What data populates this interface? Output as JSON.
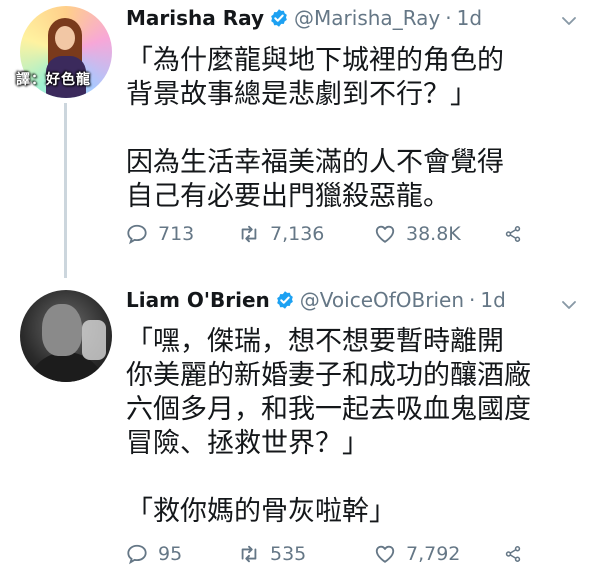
{
  "watermark": "譯：好色龍",
  "tweets": [
    {
      "name": "Marisha Ray",
      "handle": "@Marisha_Ray",
      "separator": "·",
      "time": "1d",
      "paragraphs": [
        [
          "「為什麼龍與地下城裡的角色的",
          "背景故事總是悲劇到不行？」"
        ],
        [
          "因為生活幸福美滿的人不會覺得",
          "自己有必要出門獵殺惡龍。"
        ]
      ],
      "replies": "713",
      "retweets": "7,136",
      "likes": "38.8K"
    },
    {
      "name": "Liam O'Brien",
      "handle": "@VoiceOfOBrien",
      "separator": "·",
      "time": "1d",
      "paragraphs": [
        [
          "「嘿，傑瑞，想不想要暫時離開",
          "你美麗的新婚妻子和成功的釀酒廠",
          "六個多月，和我一起去吸血鬼國度",
          "冒險、拯救世界？」"
        ],
        [
          "「救你媽的骨灰啦幹」"
        ]
      ],
      "replies": "95",
      "retweets": "535",
      "likes": "7,792"
    }
  ],
  "colors": {
    "text": "#14171a",
    "secondary": "#657786",
    "verified": "#1da1f2",
    "thread": "#ccd6dd"
  },
  "icons": [
    "verified-badge-icon",
    "chevron-down-icon",
    "reply-icon",
    "retweet-icon",
    "like-icon",
    "share-icon"
  ]
}
